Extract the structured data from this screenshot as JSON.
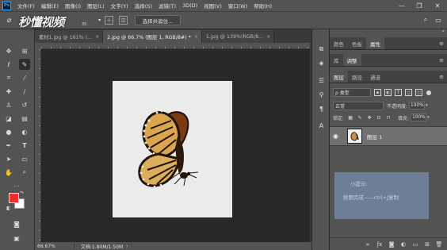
{
  "menubar": {
    "logo": "Ps",
    "items": [
      "文件(F)",
      "编辑(E)",
      "图像(I)",
      "图层(L)",
      "文字(Y)",
      "选择(S)",
      "滤镜(T)",
      "3D(D)",
      "视图(V)",
      "窗口(W)",
      "帮助(H)"
    ],
    "minimize": "—",
    "restore": "❐",
    "close": "✕"
  },
  "options": {
    "watermark": "秒懂视频",
    "watermark_number": "35",
    "select_subject": "选择并遮住...",
    "search_glyph": "⌕",
    "workspace_glyph": "▭"
  },
  "tabs": [
    {
      "label": "素材1.jpg @ 161% (...",
      "active": false
    },
    {
      "label": "2.jpg @ 66.7% (图层 1, RGB/8#) *",
      "active": true
    },
    {
      "label": "1.jpg @ 139%(RGB/8...",
      "active": false
    }
  ],
  "tab_close": "×",
  "tabs_more": "»",
  "tools": [
    "move-icon",
    "marquee-icon",
    "lasso-icon",
    "quick-select-icon",
    "crop-icon",
    "eyedropper-icon",
    "healing-icon",
    "brush-icon",
    "stamp-icon",
    "history-brush-icon",
    "eraser-icon",
    "gradient-icon",
    "blur-icon",
    "dodge-icon",
    "pen-icon",
    "type-icon",
    "path-select-icon",
    "shape-icon",
    "hand-icon",
    "zoom-icon",
    "more-icon"
  ],
  "colors": {
    "foreground": "#e8312e",
    "background": "#ffffff",
    "tip_box": "#6d7e96"
  },
  "status": {
    "zoom": "66.67%",
    "doc": "文档:1.80M/1.50M",
    "arrow": "›"
  },
  "panels": {
    "top_tabs": [
      "颜色",
      "色板",
      "属性"
    ],
    "mid_tabs": [
      "库",
      "调整"
    ],
    "layer_tabs": [
      "图层",
      "路径",
      "通道"
    ],
    "menu_glyph": "≡",
    "fold_glyph": "«"
  },
  "layers": {
    "filter_label": "ρ 类型",
    "blend_mode": "正常",
    "opacity_label": "不透明度:",
    "opacity_value": "100%",
    "lock_label": "锁定:",
    "fill_label": "填充:",
    "fill_value": "100%",
    "layer_name": "图层 1"
  },
  "tip": {
    "title": "小提示:",
    "text": "抠图完成——ctrl+J复制"
  }
}
